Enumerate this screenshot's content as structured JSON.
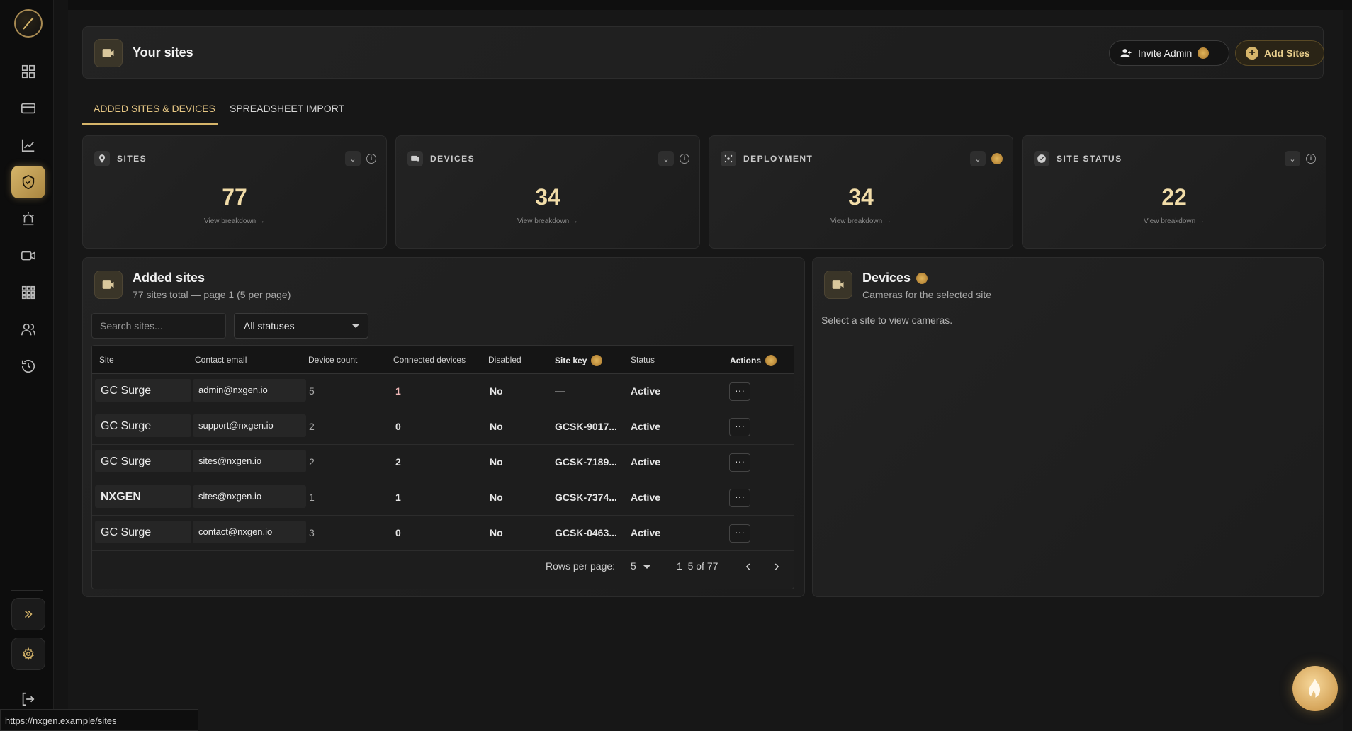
{
  "colors": {
    "accent": "#d6b56a",
    "background": "#171717",
    "card": "#222222"
  },
  "sidebar": {
    "items": [
      {
        "icon": "dashboard-icon"
      },
      {
        "icon": "card-icon"
      },
      {
        "icon": "chart-icon"
      },
      {
        "icon": "shield-icon",
        "active": true
      },
      {
        "icon": "alarm-icon"
      },
      {
        "icon": "video-icon"
      },
      {
        "icon": "grid-icon"
      },
      {
        "icon": "users-icon"
      },
      {
        "icon": "history-icon"
      }
    ]
  },
  "header": {
    "title": "Your sites",
    "invite_label": "Invite Admin",
    "add_label": "Add Sites"
  },
  "tabs": [
    {
      "label": "ADDED SITES & DEVICES",
      "active": true
    },
    {
      "label": "SPREADSHEET IMPORT"
    }
  ],
  "stats": [
    {
      "label": "SITES",
      "value": "77",
      "link": "View breakdown →"
    },
    {
      "label": "DEVICES",
      "value": "34",
      "link": "View breakdown →"
    },
    {
      "label": "DEPLOYMENT",
      "value": "34",
      "link": "View breakdown →"
    },
    {
      "label": "SITE STATUS",
      "value": "22",
      "link": "View breakdown →"
    }
  ],
  "sites": {
    "title": "Added sites",
    "subtitle": "77 sites total — page 1 (5 per page)",
    "search_placeholder": "Search sites...",
    "filter_value": "All statuses",
    "columns": [
      "Site",
      "Contact email",
      "Device count",
      "Connected devices",
      "Disabled",
      "Site key",
      "Status",
      "Actions"
    ],
    "rows": [
      {
        "site": "GC Surge",
        "email": "admin@nxgen.io",
        "count": "5",
        "connected": "1",
        "disabled": "No",
        "key": "—",
        "status": "Active"
      },
      {
        "site": "GC Surge",
        "email": "support@nxgen.io",
        "count": "2",
        "connected": "0",
        "disabled": "No",
        "key": "GCSK-9017...",
        "status": "Active"
      },
      {
        "site": "GC Surge",
        "email": "sites@nxgen.io",
        "count": "2",
        "connected": "2",
        "disabled": "No",
        "key": "GCSK-7189...",
        "status": "Active"
      },
      {
        "site": "NXGEN",
        "email": "sites@nxgen.io",
        "count": "1",
        "connected": "1",
        "disabled": "No",
        "key": "GCSK-7374...",
        "status": "Active"
      },
      {
        "site": "GC Surge",
        "email": "contact@nxgen.io",
        "count": "3",
        "connected": "0",
        "disabled": "No",
        "key": "GCSK-0463...",
        "status": "Active"
      }
    ],
    "rows_per_page_label": "Rows per page:",
    "rows_per_page": "5",
    "range": "1–5 of 77",
    "actions_glyph": "···"
  },
  "devices": {
    "title": "Devices",
    "subtitle": "Cameras for the selected site",
    "note": "Select a site to view cameras."
  },
  "status_bar_url": "https://nxgen.example/sites"
}
